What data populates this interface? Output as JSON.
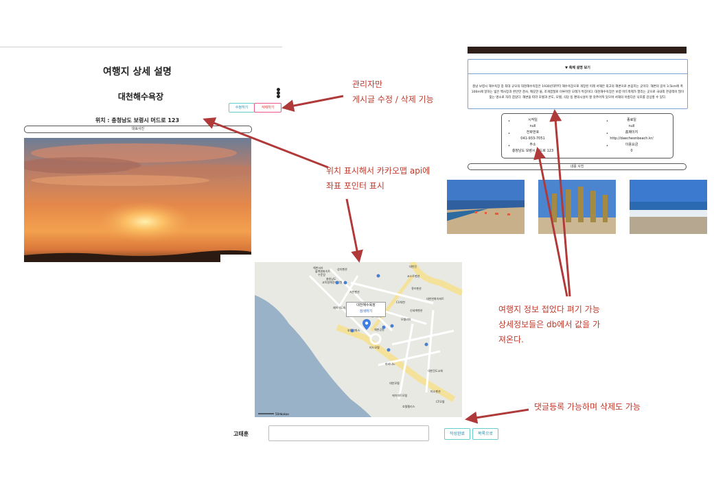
{
  "left_page": {
    "title": "여행지 상세 설명",
    "place_name": "대천해수욕장",
    "more_menu": "⋮",
    "edit_button": "수정하기",
    "delete_button": "삭제하기",
    "location": "위치 : 충청남도 보령시 머드로 123",
    "photo_button": "대표사진"
  },
  "map": {
    "popup_title": "대천해수욕장",
    "popup_link": "검색하기",
    "attribution": "kakao",
    "scale": "50m",
    "labels": [
      "해변서라",
      "블랙앤화이트",
      "수문장",
      "성지펜션",
      "충청남도",
      "교육청해양수련원",
      "대천해수욕장",
      "서천펜션",
      "성루펜션",
      "대천진",
      "큐브펜션",
      "코스트펜션",
      "CU대천",
      "모텔리아",
      "제이미도미토리",
      "해변공원",
      "호텔한화스",
      "미드모텔",
      "대천한화아파트",
      "대천진도교회",
      "대천에이프",
      "대천모텔",
      "호텔펠리스",
      "미소펜션",
      "신세계펜션",
      "에이미트모텔",
      "CF모텔",
      "마리나노",
      "창가펜션"
    ],
    "colors": {
      "sea": "#9ab2c8",
      "land": "#e9e9e4",
      "road": "#f5e29a"
    }
  },
  "comment": {
    "author": "고태훈",
    "input_value": "",
    "submit_button": "작성완료",
    "list_button": "목록으로"
  },
  "right_page": {
    "collapse_toggle": "▼ 축제 설명 보기",
    "description": "충남 보령시 해수욕장 중 최대 규모의 대천해수욕장은 1930년대부터 해수욕장으로 개장된 이래 서해안 최고의 해변으로 손꼽히는 곳이다. 해변의 길이 3.5km에 폭 100m에 달하는 넓은 백사장과 완만한 경사, 깨끗한 물, 조개껍질로 이루어진 모래가 특징이다. 대천해수욕장은 보령 머드축제가 열리는 곳으로 국내외 관광객이 많이 찾는 명소로 자리 잡았다. 해변을 따라 호텔과 콘도, 모텔, 식당 등 편의시설이 잘 갖추어져 있으며 서해의 아름다운 낙조를 감상할 수 있다.",
    "info": [
      {
        "label": "시작일",
        "value": "null"
      },
      {
        "label": "종료일",
        "value": "null"
      },
      {
        "label": "전화번호",
        "value": "041-933-7051"
      },
      {
        "label": "홈페이지",
        "value": "http://daecheonbeach.kr/"
      },
      {
        "label": "주소",
        "value": "충청남도 보령시 머드로 123"
      },
      {
        "label": "이용요금",
        "value": "0"
      }
    ],
    "bullet": "•",
    "more_photos": "내용 사진"
  },
  "annotations": {
    "admin": [
      "관리자만",
      "게시글 수정 / 삭제 기능"
    ],
    "kakao": [
      "위치 표시해서 카카오맵 api에",
      "좌표 포인터 표시"
    ],
    "db": [
      "여행지 정보 접었다 펴기 가능",
      "상세정보들은 db에서 값을 가",
      "져온다."
    ],
    "comments": "댓글등록 가능하며 삭제도 가능",
    "color": "#c0392b"
  }
}
